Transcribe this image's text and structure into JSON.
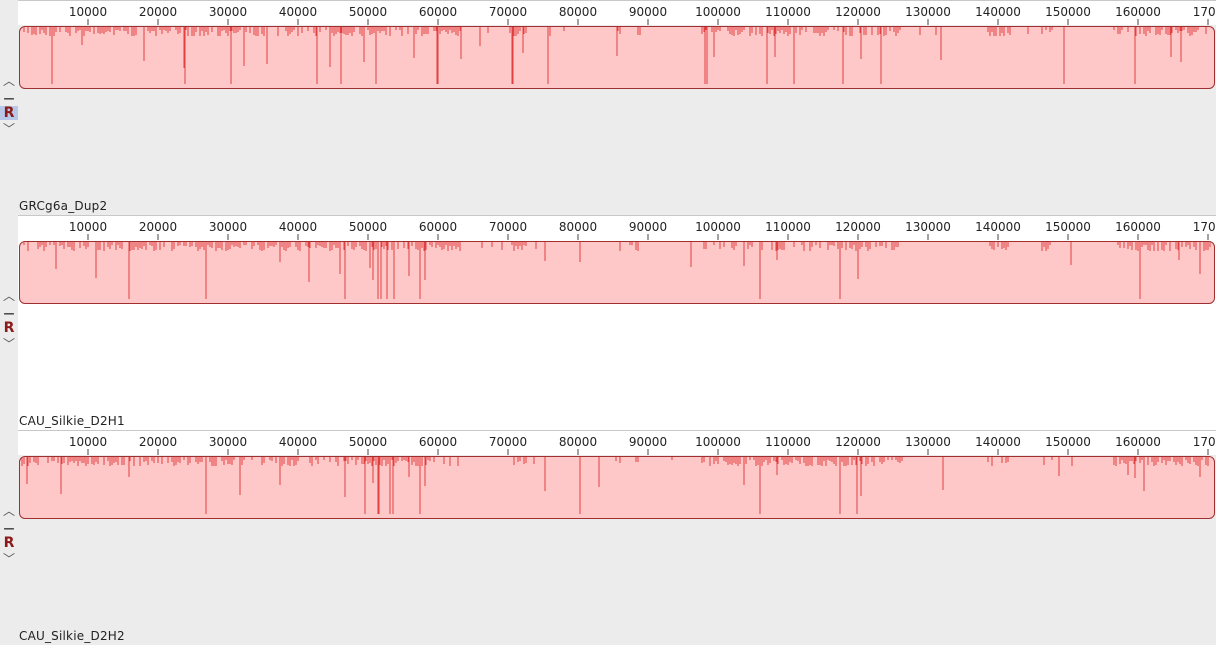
{
  "ruler": {
    "ticks": [
      "10000",
      "20000",
      "30000",
      "40000",
      "50000",
      "60000",
      "70000",
      "80000",
      "90000",
      "100000",
      "110000",
      "120000",
      "130000",
      "140000",
      "150000",
      "160000",
      "1700"
    ]
  },
  "panels": [
    {
      "name": "GRCg6a_Dup2",
      "ref_label": "R",
      "ref_selected": true,
      "deep_gaps": [
        0.027,
        0.138,
        0.177,
        0.249,
        0.269,
        0.298,
        0.349,
        0.35,
        0.412,
        0.413,
        0.442,
        0.574,
        0.575,
        0.626,
        0.648,
        0.689,
        0.721,
        0.874,
        0.934
      ],
      "mid_gaps": [
        0.052,
        0.104,
        0.137,
        0.188,
        0.207,
        0.26,
        0.288,
        0.33,
        0.369,
        0.385,
        0.421,
        0.5,
        0.581,
        0.632,
        0.704,
        0.771,
        0.964,
        0.972
      ]
    },
    {
      "name": "CAU_Silkie_D2H1",
      "ref_label": "R",
      "ref_selected": false,
      "deep_gaps": [
        0.091,
        0.156,
        0.272,
        0.3,
        0.302,
        0.307,
        0.313,
        0.335,
        0.62,
        0.687,
        0.938
      ],
      "mid_gaps": [
        0.03,
        0.064,
        0.218,
        0.242,
        0.268,
        0.293,
        0.296,
        0.326,
        0.339,
        0.44,
        0.469,
        0.562,
        0.606,
        0.634,
        0.702,
        0.88,
        0.971,
        0.988
      ]
    },
    {
      "name": "CAU_Silkie_D2H2",
      "ref_label": "R",
      "ref_selected": false,
      "deep_gaps": [
        0.156,
        0.289,
        0.3,
        0.301,
        0.31,
        0.312,
        0.335,
        0.469,
        0.62,
        0.687,
        0.701
      ],
      "mid_gaps": [
        0.006,
        0.034,
        0.091,
        0.184,
        0.218,
        0.272,
        0.296,
        0.326,
        0.339,
        0.44,
        0.485,
        0.606,
        0.634,
        0.704,
        0.773,
        0.87,
        0.928,
        0.934,
        0.941,
        0.988
      ]
    }
  ]
}
